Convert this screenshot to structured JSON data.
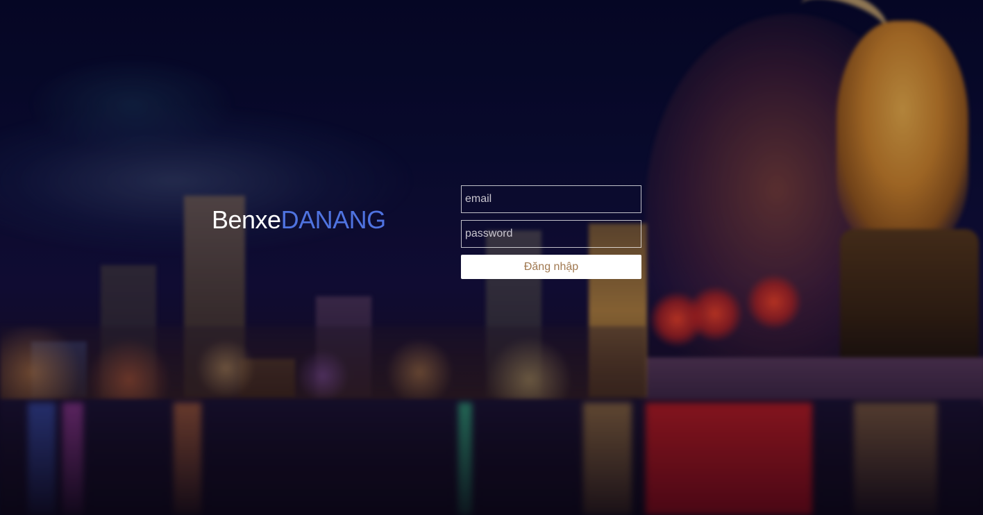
{
  "brand": {
    "part1": "Benxe",
    "part2": "DANANG",
    "accent_color": "#4f73e0"
  },
  "login": {
    "email_placeholder": "email",
    "email_value": "",
    "password_placeholder": "password",
    "password_value": "",
    "submit_label": "Đăng nhập",
    "submit_text_color": "#a07850"
  },
  "background": {
    "description_icon": "night-city-skyline-image"
  }
}
